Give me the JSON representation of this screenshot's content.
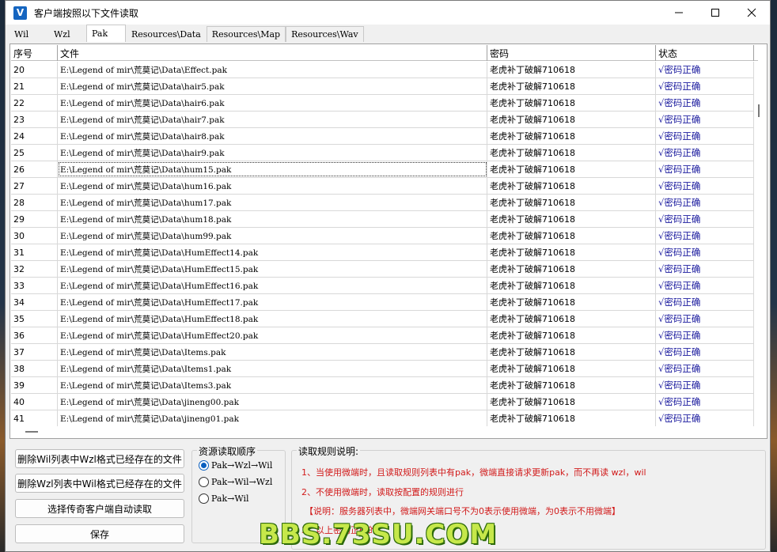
{
  "window": {
    "title": "客户端按照以下文件读取",
    "icon_letter": "V"
  },
  "tabs": [
    {
      "label": "Wil"
    },
    {
      "label": "Wzl"
    },
    {
      "label": "Pak"
    },
    {
      "label": "Resources\\Data"
    },
    {
      "label": "Resources\\Map"
    },
    {
      "label": "Resources\\Wav"
    }
  ],
  "grid": {
    "columns": [
      "序号",
      "文件",
      "密码",
      "状态"
    ],
    "rows": [
      [
        "20",
        "E:\\Legend of mir\\荒莫记\\Data\\Effect.pak",
        "老虎补丁破解710618",
        "√密码正确"
      ],
      [
        "21",
        "E:\\Legend of mir\\荒莫记\\Data\\hair5.pak",
        "老虎补丁破解710618",
        "√密码正确"
      ],
      [
        "22",
        "E:\\Legend of mir\\荒莫记\\Data\\hair6.pak",
        "老虎补丁破解710618",
        "√密码正确"
      ],
      [
        "23",
        "E:\\Legend of mir\\荒莫记\\Data\\hair7.pak",
        "老虎补丁破解710618",
        "√密码正确"
      ],
      [
        "24",
        "E:\\Legend of mir\\荒莫记\\Data\\hair8.pak",
        "老虎补丁破解710618",
        "√密码正确"
      ],
      [
        "25",
        "E:\\Legend of mir\\荒莫记\\Data\\hair9.pak",
        "老虎补丁破解710618",
        "√密码正确"
      ],
      [
        "26",
        "E:\\Legend of mir\\荒莫记\\Data\\hum15.pak",
        "老虎补丁破解710618",
        "√密码正确"
      ],
      [
        "27",
        "E:\\Legend of mir\\荒莫记\\Data\\hum16.pak",
        "老虎补丁破解710618",
        "√密码正确"
      ],
      [
        "28",
        "E:\\Legend of mir\\荒莫记\\Data\\hum17.pak",
        "老虎补丁破解710618",
        "√密码正确"
      ],
      [
        "29",
        "E:\\Legend of mir\\荒莫记\\Data\\hum18.pak",
        "老虎补丁破解710618",
        "√密码正确"
      ],
      [
        "30",
        "E:\\Legend of mir\\荒莫记\\Data\\hum99.pak",
        "老虎补丁破解710618",
        "√密码正确"
      ],
      [
        "31",
        "E:\\Legend of mir\\荒莫记\\Data\\HumEffect14.pak",
        "老虎补丁破解710618",
        "√密码正确"
      ],
      [
        "32",
        "E:\\Legend of mir\\荒莫记\\Data\\HumEffect15.pak",
        "老虎补丁破解710618",
        "√密码正确"
      ],
      [
        "33",
        "E:\\Legend of mir\\荒莫记\\Data\\HumEffect16.pak",
        "老虎补丁破解710618",
        "√密码正确"
      ],
      [
        "34",
        "E:\\Legend of mir\\荒莫记\\Data\\HumEffect17.pak",
        "老虎补丁破解710618",
        "√密码正确"
      ],
      [
        "35",
        "E:\\Legend of mir\\荒莫记\\Data\\HumEffect18.pak",
        "老虎补丁破解710618",
        "√密码正确"
      ],
      [
        "36",
        "E:\\Legend of mir\\荒莫记\\Data\\HumEffect20.pak",
        "老虎补丁破解710618",
        "√密码正确"
      ],
      [
        "37",
        "E:\\Legend of mir\\荒莫记\\Data\\Items.pak",
        "老虎补丁破解710618",
        "√密码正确"
      ],
      [
        "38",
        "E:\\Legend of mir\\荒莫记\\Data\\Items1.pak",
        "老虎补丁破解710618",
        "√密码正确"
      ],
      [
        "39",
        "E:\\Legend of mir\\荒莫记\\Data\\Items3.pak",
        "老虎补丁破解710618",
        "√密码正确"
      ],
      [
        "40",
        "E:\\Legend of mir\\荒莫记\\Data\\jineng00.pak",
        "老虎补丁破解710618",
        "√密码正确"
      ],
      [
        "41",
        "E:\\Legend of mir\\荒莫记\\Data\\jineng01.pak",
        "老虎补丁破解710618",
        "√密码正确"
      ]
    ]
  },
  "buttons": {
    "delete_wil": "删除Wil列表中Wzl格式已经存在的文件",
    "delete_wzl": "删除Wzl列表中Wil格式已经存在的文件",
    "select_client": "选择传奇客户端自动读取",
    "save": "保存"
  },
  "order_group": {
    "title": "资源读取顺序",
    "options": [
      {
        "label": "Pak→Wzl→Wil",
        "checked": true
      },
      {
        "label": "Pak→Wil→Wzl",
        "checked": false
      },
      {
        "label": "Pak→Wil",
        "checked": false
      }
    ]
  },
  "rules": {
    "title": "读取规则说明:",
    "lines": [
      "1、当使用微端时，且读取规则列表中有pak，微端直接请求更新pak，而不再读 wzl，wil",
      "2、不使用微端时，读取按配置的规则进行",
      "【说明：服务器列表中，微端网关端口号不为0表示使用微端，为0表示不用微端】",
      "3、以上密码正确的"
    ]
  },
  "watermark": "BBS.73SU.COM",
  "colors": {
    "status_text": "#1a1a9e",
    "rules_text": "#d11a1a",
    "radio_checked": "#0a5fbf"
  }
}
